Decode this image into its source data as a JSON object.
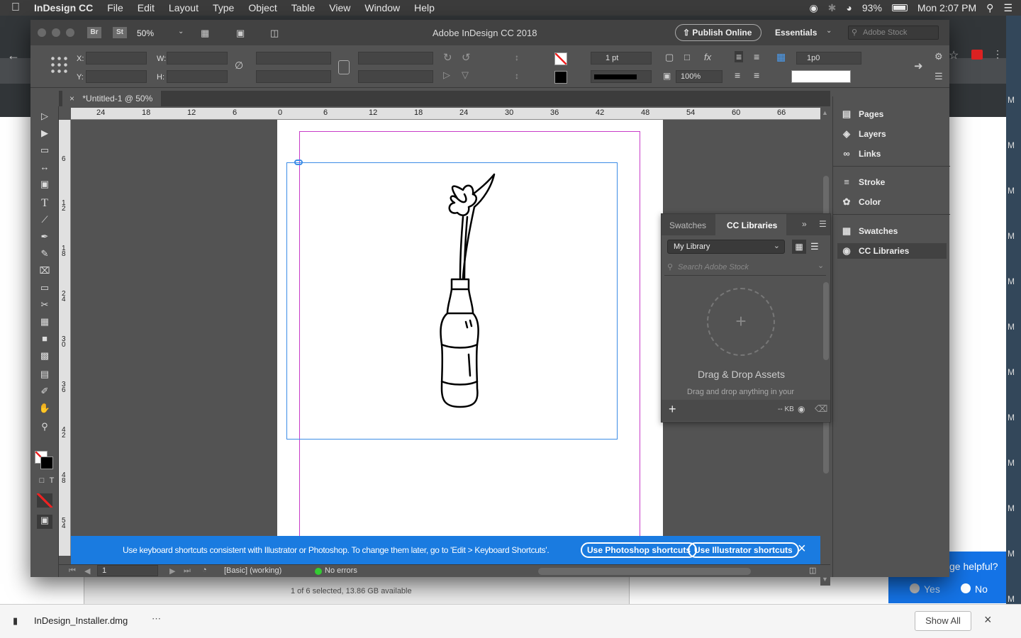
{
  "menubar": {
    "app_name": "InDesign CC",
    "items": [
      "File",
      "Edit",
      "Layout",
      "Type",
      "Object",
      "Table",
      "View",
      "Window",
      "Help"
    ],
    "battery": "93%",
    "clock": "Mon 2:07 PM"
  },
  "window": {
    "title": "Adobe InDesign CC 2018",
    "zoom": "50%",
    "bridge": "Br",
    "stock": "St",
    "publish_label": "Publish Online",
    "workspace": "Essentials",
    "stock_search_placeholder": "Adobe Stock"
  },
  "control": {
    "x_label": "X:",
    "y_label": "Y:",
    "w_label": "W:",
    "h_label": "H:",
    "stroke_weight": "1 pt",
    "opacity": "100%",
    "gap": "1p0"
  },
  "document": {
    "tab_label": "*Untitled-1 @ 50%"
  },
  "ruler_h": [
    "24",
    "18",
    "12",
    "6",
    "0",
    "6",
    "12",
    "18",
    "24",
    "30",
    "36",
    "42",
    "48",
    "54",
    "60",
    "66"
  ],
  "ruler_v": [
    "6",
    "1 2",
    "1 8",
    "2 4",
    "3 0",
    "3 6",
    "4 2",
    "4 8",
    "5 4"
  ],
  "banner": {
    "message": "Use keyboard shortcuts consistent with Illustrator or Photoshop. To change them later, go to 'Edit > Keyboard Shortcuts'.",
    "photoshop_button": "Use Photoshop shortcuts",
    "illustrator_button": "Use Illustrator shortcuts"
  },
  "status": {
    "page": "1",
    "preflight_profile": "[Basic] (working)",
    "errors": "No errors"
  },
  "cc_panel": {
    "tab_swatches": "Swatches",
    "tab_cc": "CC Libraries",
    "library": "My Library",
    "search_placeholder": "Search Adobe Stock",
    "drop_title": "Drag & Drop Assets",
    "drop_sub": "Drag and drop anything in your",
    "size": "-- KB"
  },
  "dock": {
    "pages": "Pages",
    "layers": "Layers",
    "links": "Links",
    "stroke": "Stroke",
    "color": "Color",
    "swatches": "Swatches",
    "cc_libraries": "CC Libraries"
  },
  "behind": {
    "finder_status": "1 of 6 selected, 13.86 GB available",
    "helpful_q": "ge helpful?",
    "yes": "Yes",
    "no": "No"
  },
  "downloads": {
    "file": "InDesign_Installer.dmg",
    "show_all": "Show All"
  },
  "colors": {
    "accent": "#1473e6",
    "banner": "#1a7be0",
    "margin_guide": "#c83cc8",
    "frame": "#3c8ce6"
  }
}
